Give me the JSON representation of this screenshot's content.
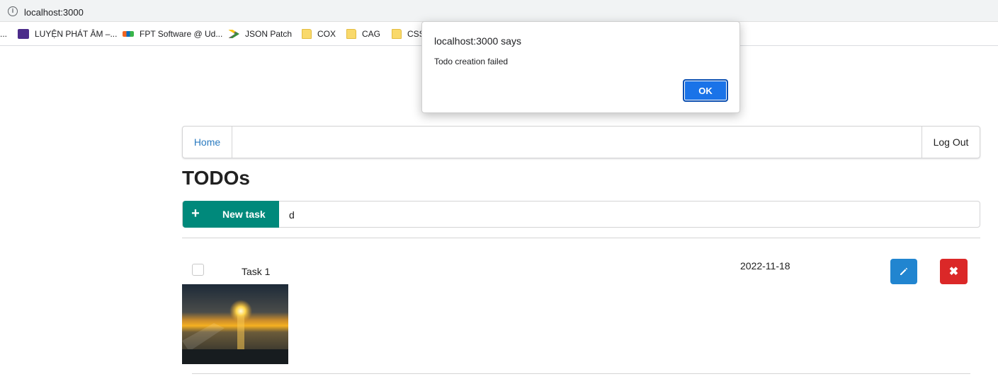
{
  "browser": {
    "url": "localhost:3000",
    "bookmarks": [
      {
        "label": "LUYỆN PHÁT ÂM –...",
        "icon": "purple-site-icon"
      },
      {
        "label": "FPT Software @ Ud...",
        "icon": "fpt-logo-icon"
      },
      {
        "label": "JSON Patch",
        "icon": "json-patch-icon"
      },
      {
        "label": "COX",
        "icon": "folder-icon"
      },
      {
        "label": "CAG",
        "icon": "folder-icon"
      },
      {
        "label": "CSS",
        "icon": "folder-icon"
      }
    ]
  },
  "nav": {
    "home": "Home",
    "logout": "Log Out"
  },
  "page": {
    "title": "TODOs"
  },
  "new_task": {
    "button_label": "New task",
    "input_value": "d"
  },
  "tasks": [
    {
      "name": "Task 1",
      "date": "2022-11-18",
      "done": false,
      "has_image": true
    }
  ],
  "dialog": {
    "title": "localhost:3000 says",
    "message": "Todo creation failed",
    "ok": "OK"
  },
  "colors": {
    "accent_teal": "#00897b",
    "edit_blue": "#2185d0",
    "delete_red": "#db2828",
    "link_blue": "#2b7bc0",
    "ok_blue": "#1a73e8"
  }
}
